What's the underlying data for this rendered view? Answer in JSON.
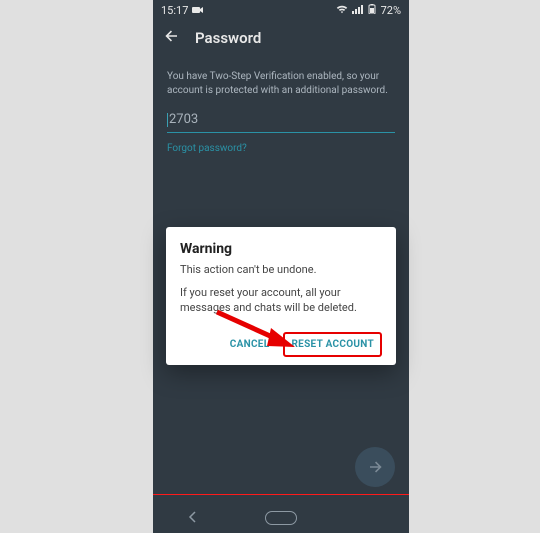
{
  "statusbar": {
    "time": "15:17",
    "battery": "72%"
  },
  "appbar": {
    "title": "Password"
  },
  "description": "You have Two-Step Verification enabled, so your account is protected with an additional password.",
  "input_value": "2703",
  "forgot": "Forgot password?",
  "dialog": {
    "title": "Warning",
    "line1": "This action can't be undone.",
    "line2": "If you reset your account, all your messages and chats will be deleted.",
    "cancel": "CANCEL",
    "reset": "RESET ACCOUNT"
  }
}
